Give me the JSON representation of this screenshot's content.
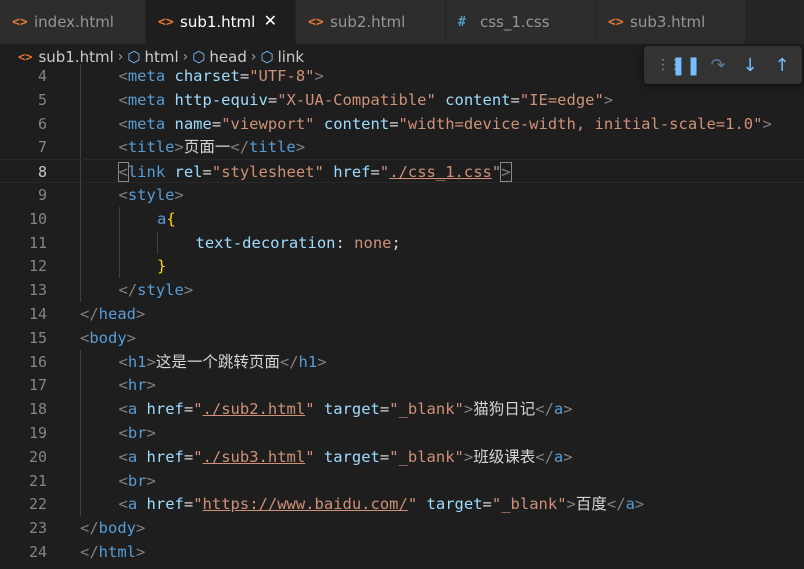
{
  "tabs": [
    {
      "icon": "<>",
      "label": "index.html",
      "active": false
    },
    {
      "icon": "<>",
      "label": "sub1.html",
      "active": true
    },
    {
      "icon": "<>",
      "label": "sub2.html",
      "active": false
    },
    {
      "icon": "#",
      "label": "css_1.css",
      "active": false
    },
    {
      "icon": "<>",
      "label": "sub3.html",
      "active": false
    }
  ],
  "active_tab_close": "✕",
  "breadcrumb": {
    "file": "sub1.html",
    "items": [
      "html",
      "head",
      "link"
    ]
  },
  "debug_toolbar": {
    "buttons": [
      "pause-icon",
      "step-over-icon",
      "step-into-icon",
      "step-out-icon"
    ]
  },
  "editor": {
    "current_line": 8,
    "lines": [
      {
        "n": "4",
        "indent": 1,
        "parts": [
          [
            "tg",
            "<"
          ],
          [
            "tn",
            "meta"
          ],
          [
            "tx",
            " "
          ],
          [
            "at",
            "charset"
          ],
          [
            "tx",
            "="
          ],
          [
            "st",
            "\"UTF-8\""
          ],
          [
            "tg",
            ">"
          ]
        ]
      },
      {
        "n": "5",
        "indent": 1,
        "parts": [
          [
            "tg",
            "<"
          ],
          [
            "tn",
            "meta"
          ],
          [
            "tx",
            " "
          ],
          [
            "at",
            "http-equiv"
          ],
          [
            "tx",
            "="
          ],
          [
            "st",
            "\"X-UA-Compatible\""
          ],
          [
            "tx",
            " "
          ],
          [
            "at",
            "content"
          ],
          [
            "tx",
            "="
          ],
          [
            "st",
            "\"IE=edge\""
          ],
          [
            "tg",
            ">"
          ]
        ]
      },
      {
        "n": "6",
        "indent": 1,
        "parts": [
          [
            "tg",
            "<"
          ],
          [
            "tn",
            "meta"
          ],
          [
            "tx",
            " "
          ],
          [
            "at",
            "name"
          ],
          [
            "tx",
            "="
          ],
          [
            "st",
            "\"viewport\""
          ],
          [
            "tx",
            " "
          ],
          [
            "at",
            "content"
          ],
          [
            "tx",
            "="
          ],
          [
            "st",
            "\"width=device-width, initial-scale=1.0\""
          ],
          [
            "tg",
            ">"
          ]
        ]
      },
      {
        "n": "7",
        "indent": 1,
        "parts": [
          [
            "tg",
            "<"
          ],
          [
            "tn",
            "title"
          ],
          [
            "tg",
            ">"
          ],
          [
            "tx",
            "页面一"
          ],
          [
            "tg",
            "</"
          ],
          [
            "tn",
            "title"
          ],
          [
            "tg",
            ">"
          ]
        ]
      },
      {
        "n": "8",
        "indent": 1,
        "parts": [
          [
            "tg box",
            "<"
          ],
          [
            "tn",
            "link"
          ],
          [
            "tx",
            " "
          ],
          [
            "at",
            "rel"
          ],
          [
            "tx",
            "="
          ],
          [
            "st",
            "\"stylesheet\""
          ],
          [
            "tx",
            " "
          ],
          [
            "at",
            "href"
          ],
          [
            "tx",
            "="
          ],
          [
            "st",
            "\""
          ],
          [
            "st ul",
            "./css_1.css"
          ],
          [
            "st",
            "\""
          ],
          [
            "tg box",
            ">"
          ]
        ]
      },
      {
        "n": "9",
        "indent": 1,
        "parts": [
          [
            "tg",
            "<"
          ],
          [
            "tn",
            "style"
          ],
          [
            "tg",
            ">"
          ]
        ]
      },
      {
        "n": "10",
        "indent": 2,
        "parts": [
          [
            "tn",
            "a"
          ],
          [
            "br",
            "{"
          ]
        ]
      },
      {
        "n": "11",
        "indent": 3,
        "parts": [
          [
            "at",
            "text-decoration"
          ],
          [
            "tx",
            ": "
          ],
          [
            "st",
            "none"
          ],
          [
            "tx",
            ";"
          ]
        ]
      },
      {
        "n": "12",
        "indent": 2,
        "parts": [
          [
            "br",
            "}"
          ]
        ]
      },
      {
        "n": "13",
        "indent": 1,
        "parts": [
          [
            "tg",
            "</"
          ],
          [
            "tn",
            "style"
          ],
          [
            "tg",
            ">"
          ]
        ]
      },
      {
        "n": "14",
        "indent": 0,
        "parts": [
          [
            "tg",
            "</"
          ],
          [
            "tn",
            "head"
          ],
          [
            "tg",
            ">"
          ]
        ]
      },
      {
        "n": "15",
        "indent": 0,
        "parts": [
          [
            "tg",
            "<"
          ],
          [
            "tn",
            "body"
          ],
          [
            "tg",
            ">"
          ]
        ]
      },
      {
        "n": "16",
        "indent": 1,
        "parts": [
          [
            "tg",
            "<"
          ],
          [
            "tn",
            "h1"
          ],
          [
            "tg",
            ">"
          ],
          [
            "tx",
            "这是一个跳转页面"
          ],
          [
            "tg",
            "</"
          ],
          [
            "tn",
            "h1"
          ],
          [
            "tg",
            ">"
          ]
        ]
      },
      {
        "n": "17",
        "indent": 1,
        "parts": [
          [
            "tg",
            "<"
          ],
          [
            "tn",
            "hr"
          ],
          [
            "tg",
            ">"
          ]
        ]
      },
      {
        "n": "18",
        "indent": 1,
        "parts": [
          [
            "tg",
            "<"
          ],
          [
            "tn",
            "a"
          ],
          [
            "tx",
            " "
          ],
          [
            "at",
            "href"
          ],
          [
            "tx",
            "="
          ],
          [
            "st",
            "\""
          ],
          [
            "st ul",
            "./sub2.html"
          ],
          [
            "st",
            "\""
          ],
          [
            "tx",
            " "
          ],
          [
            "at",
            "target"
          ],
          [
            "tx",
            "="
          ],
          [
            "st",
            "\"_blank\""
          ],
          [
            "tg",
            ">"
          ],
          [
            "tx",
            "猫狗日记"
          ],
          [
            "tg",
            "</"
          ],
          [
            "tn",
            "a"
          ],
          [
            "tg",
            ">"
          ]
        ]
      },
      {
        "n": "19",
        "indent": 1,
        "parts": [
          [
            "tg",
            "<"
          ],
          [
            "tn",
            "br"
          ],
          [
            "tg",
            ">"
          ]
        ]
      },
      {
        "n": "20",
        "indent": 1,
        "parts": [
          [
            "tg",
            "<"
          ],
          [
            "tn",
            "a"
          ],
          [
            "tx",
            " "
          ],
          [
            "at",
            "href"
          ],
          [
            "tx",
            "="
          ],
          [
            "st",
            "\""
          ],
          [
            "st ul",
            "./sub3.html"
          ],
          [
            "st",
            "\""
          ],
          [
            "tx",
            " "
          ],
          [
            "at",
            "target"
          ],
          [
            "tx",
            "="
          ],
          [
            "st",
            "\"_blank\""
          ],
          [
            "tg",
            ">"
          ],
          [
            "tx",
            "班级课表"
          ],
          [
            "tg",
            "</"
          ],
          [
            "tn",
            "a"
          ],
          [
            "tg",
            ">"
          ]
        ]
      },
      {
        "n": "21",
        "indent": 1,
        "parts": [
          [
            "tg",
            "<"
          ],
          [
            "tn",
            "br"
          ],
          [
            "tg",
            ">"
          ]
        ]
      },
      {
        "n": "22",
        "indent": 1,
        "parts": [
          [
            "tg",
            "<"
          ],
          [
            "tn",
            "a"
          ],
          [
            "tx",
            " "
          ],
          [
            "at",
            "href"
          ],
          [
            "tx",
            "="
          ],
          [
            "st",
            "\""
          ],
          [
            "st ul",
            "https://www.baidu.com/"
          ],
          [
            "st",
            "\""
          ],
          [
            "tx",
            " "
          ],
          [
            "at",
            "target"
          ],
          [
            "tx",
            "="
          ],
          [
            "st",
            "\"_blank\""
          ],
          [
            "tg",
            ">"
          ],
          [
            "tx",
            "百度"
          ],
          [
            "tg",
            "</"
          ],
          [
            "tn",
            "a"
          ],
          [
            "tg",
            ">"
          ]
        ]
      },
      {
        "n": "23",
        "indent": 0,
        "parts": [
          [
            "tg",
            "</"
          ],
          [
            "tn",
            "body"
          ],
          [
            "tg",
            ">"
          ]
        ]
      },
      {
        "n": "24",
        "indent": 0,
        "parts": [
          [
            "tg",
            "</"
          ],
          [
            "tn",
            "html"
          ],
          [
            "tg",
            ">"
          ]
        ]
      }
    ]
  }
}
